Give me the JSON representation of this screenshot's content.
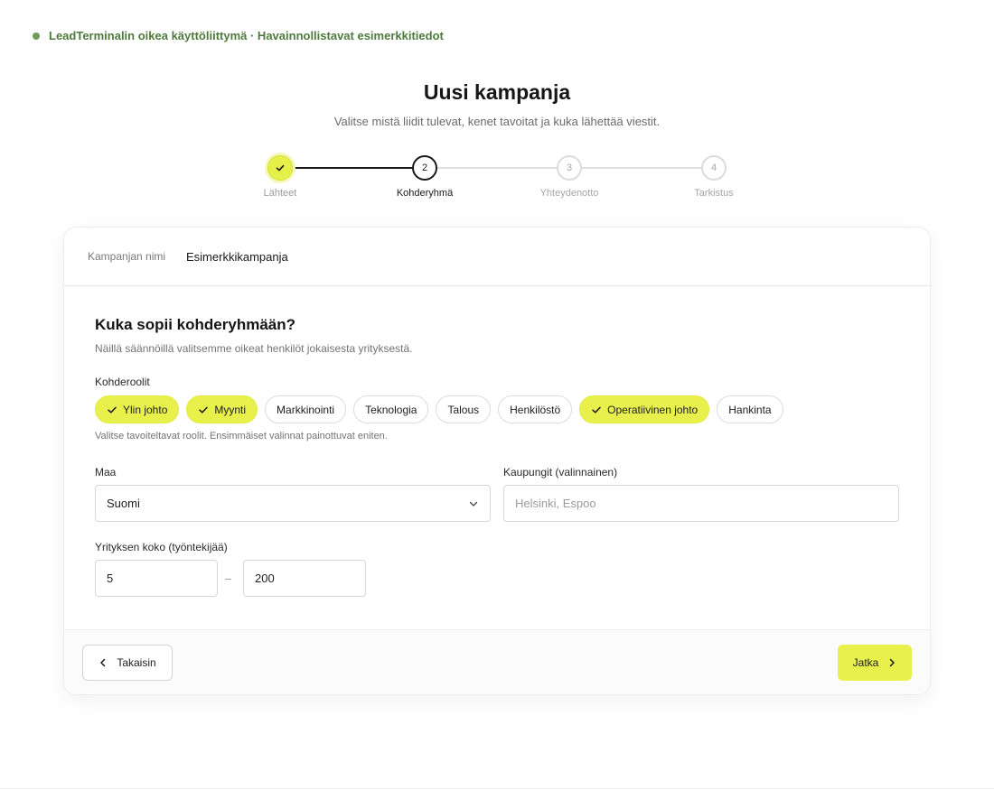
{
  "banner": {
    "text": "LeadTerminalin oikea käyttöliittymä · Havainnollistavat esimerkkitiedot"
  },
  "header": {
    "title": "Uusi kampanja",
    "subtitle": "Valitse mistä liidit tulevat, kenet tavoitat ja kuka lähettää viestit."
  },
  "steps": [
    {
      "number": "1",
      "label": "Lähteet",
      "state": "done"
    },
    {
      "number": "2",
      "label": "Kohderyhmä",
      "state": "active"
    },
    {
      "number": "3",
      "label": "Yhteydenotto",
      "state": "todo"
    },
    {
      "number": "4",
      "label": "Tarkistus",
      "state": "todo"
    }
  ],
  "campaign": {
    "name_label": "Kampanjan nimi",
    "name_value": "Esimerkkikampanja"
  },
  "section": {
    "title": "Kuka sopii kohderyhmään?",
    "description": "Näillä säännöillä valitsemme oikeat henkilöt jokaisesta yrityksestä."
  },
  "roles": {
    "label": "Kohderoolit",
    "hint": "Valitse tavoiteltavat roolit. Ensimmäiset valinnat painottuvat eniten.",
    "chips": [
      {
        "label": "Ylin johto",
        "selected": true
      },
      {
        "label": "Myynti",
        "selected": true
      },
      {
        "label": "Markkinointi",
        "selected": false
      },
      {
        "label": "Teknologia",
        "selected": false
      },
      {
        "label": "Talous",
        "selected": false
      },
      {
        "label": "Henkilöstö",
        "selected": false
      },
      {
        "label": "Operatiivinen johto",
        "selected": true
      },
      {
        "label": "Hankinta",
        "selected": false
      }
    ]
  },
  "country": {
    "label": "Maa",
    "value": "Suomi"
  },
  "cities": {
    "label": "Kaupungit (valinnainen)",
    "placeholder": "Helsinki, Espoo",
    "value": ""
  },
  "company_size": {
    "label": "Yrityksen koko (työntekijää)",
    "min": "5",
    "max": "200",
    "separator": "–"
  },
  "footer": {
    "back_label": "Takaisin",
    "next_label": "Jatka"
  },
  "colors": {
    "accent": "#e8f04c",
    "banner_green": "#4e7a3e",
    "text": "#141414"
  }
}
